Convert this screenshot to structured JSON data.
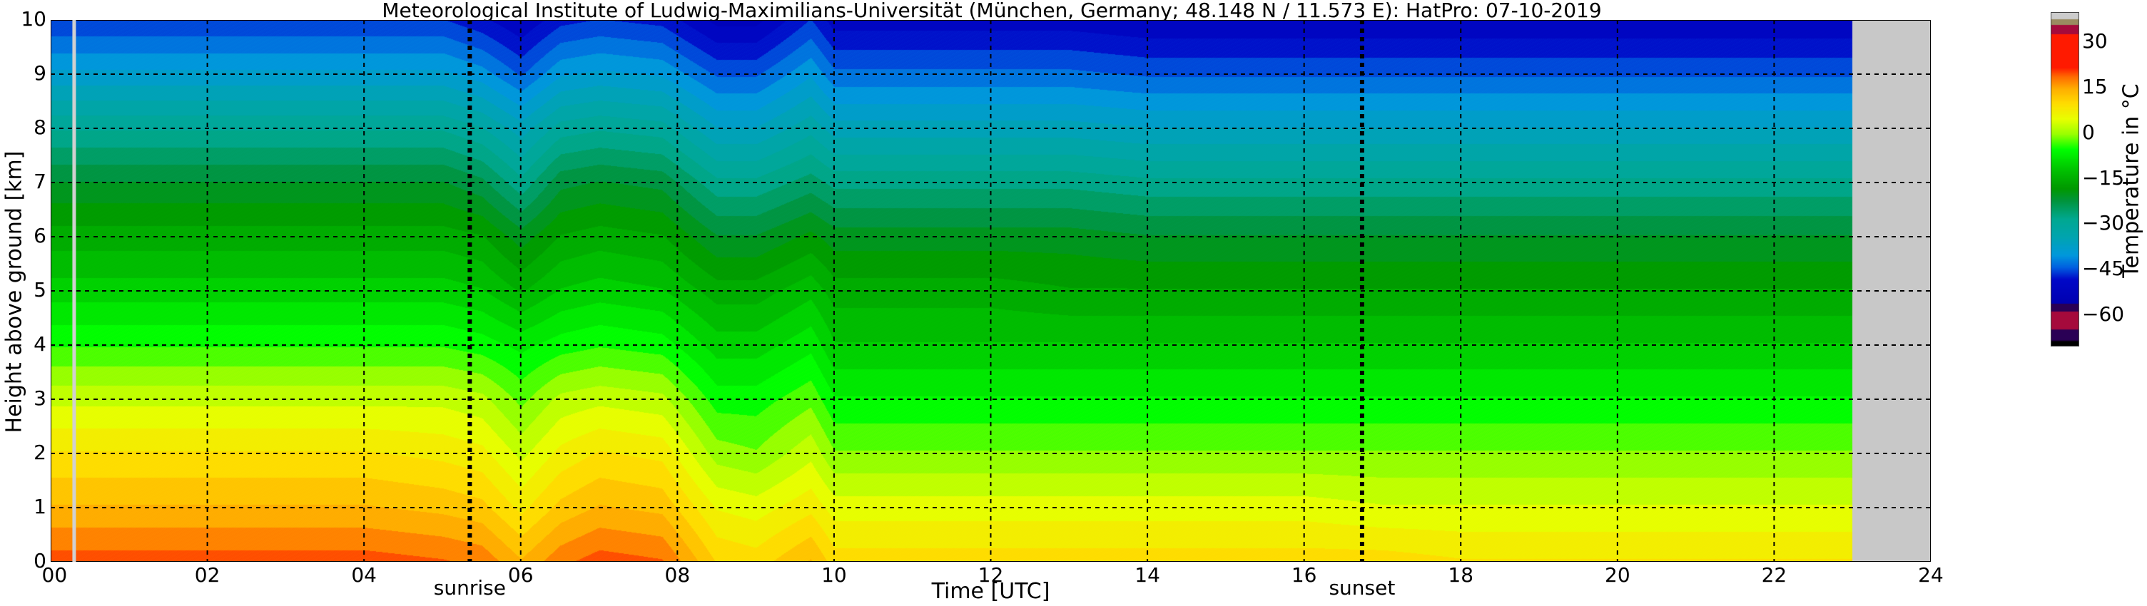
{
  "chart_data": {
    "type": "heatmap",
    "title": "Meteorological Institute of Ludwig-Maximilians-Universität (München, Germany; 48.148 N / 11.573 E):     HatPro: 07-10-2019",
    "xlabel": "Time [UTC]",
    "ylabel": "Height above ground [km]",
    "colorbar_label": "Temperature in °C",
    "xlim": [
      0,
      24
    ],
    "ylim": [
      0,
      10
    ],
    "clim": [
      -70,
      40
    ],
    "xticks": [
      "00",
      "02",
      "04",
      "06",
      "08",
      "10",
      "12",
      "14",
      "16",
      "18",
      "20",
      "22",
      "24"
    ],
    "xtick_values": [
      0,
      2,
      4,
      6,
      8,
      10,
      12,
      14,
      16,
      18,
      20,
      22,
      24
    ],
    "yticks": [
      "0",
      "1",
      "2",
      "3",
      "4",
      "5",
      "6",
      "7",
      "8",
      "9",
      "10"
    ],
    "cticks": [
      "30",
      "15",
      "0",
      "−15",
      "−30",
      "−45",
      "−60"
    ],
    "ctick_values": [
      30,
      15,
      0,
      -15,
      -30,
      -45,
      -60
    ],
    "grid": true,
    "annotations": [
      {
        "label": "sunrise",
        "time": 5.35
      },
      {
        "label": "sunset",
        "time": 16.74
      }
    ],
    "no_data_from": 23.0,
    "gap_line_time": 0.3,
    "heights": [
      0,
      1,
      2,
      3,
      4,
      5,
      6,
      7,
      8,
      9,
      10
    ],
    "times": [
      0,
      1,
      2,
      3,
      4,
      5,
      5.5,
      6,
      6.5,
      7,
      7.8,
      8.5,
      9,
      9.7,
      10,
      11,
      12,
      13,
      14,
      15,
      16,
      17,
      18,
      19,
      20,
      21,
      22,
      23
    ],
    "z": [
      [
        20,
        14,
        9,
        3,
        -4,
        -10,
        -15,
        -21,
        -29,
        -38,
        -46
      ],
      [
        20,
        14,
        9,
        3,
        -4,
        -10,
        -15,
        -21,
        -29,
        -38,
        -46
      ],
      [
        20,
        14,
        9,
        3,
        -4,
        -10,
        -15,
        -21,
        -29,
        -38,
        -46
      ],
      [
        20,
        14,
        9,
        3,
        -4,
        -10,
        -15,
        -21,
        -29,
        -38,
        -46
      ],
      [
        20,
        14,
        9,
        3,
        -4,
        -10,
        -15,
        -21,
        -29,
        -38,
        -46
      ],
      [
        19,
        13,
        8,
        3,
        -4,
        -10,
        -15,
        -21,
        -29,
        -38,
        -46
      ],
      [
        18,
        12,
        7,
        2,
        -5,
        -11,
        -16,
        -23,
        -31,
        -40,
        -48
      ],
      [
        14,
        8,
        3,
        -2,
        -7,
        -14,
        -20,
        -28,
        -35,
        -44,
        -51
      ],
      [
        18,
        12,
        7,
        2,
        -5,
        -11,
        -16,
        -22,
        -30,
        -39,
        -47
      ],
      [
        20,
        14,
        9,
        3,
        -4,
        -10,
        -15,
        -21,
        -29,
        -38,
        -46
      ],
      [
        19,
        13,
        8,
        2,
        -5,
        -11,
        -16,
        -22,
        -30,
        -39,
        -47
      ],
      [
        11,
        6,
        0,
        -5,
        -10,
        -15,
        -21,
        -28,
        -36,
        -44,
        -52
      ],
      [
        10,
        5,
        -1,
        -5,
        -10,
        -15,
        -21,
        -28,
        -36,
        -44,
        -52
      ],
      [
        14,
        8,
        3,
        -2,
        -7,
        -12,
        -18,
        -25,
        -32,
        -39,
        -46
      ],
      [
        10,
        5,
        -1,
        -6,
        -11,
        -15,
        -20,
        -27,
        -35,
        -43,
        -50
      ],
      [
        10,
        5,
        -1,
        -6,
        -11,
        -15,
        -20,
        -27,
        -35,
        -43,
        -50
      ],
      [
        10,
        5,
        -1,
        -6,
        -11,
        -15,
        -20,
        -27,
        -35,
        -43,
        -50
      ],
      [
        10,
        5,
        -1,
        -6,
        -11,
        -16,
        -20,
        -27,
        -35,
        -43,
        -50
      ],
      [
        10,
        5,
        -1,
        -6,
        -11,
        -16,
        -21,
        -28,
        -36,
        -44,
        -51
      ],
      [
        10,
        5,
        -1,
        -6,
        -11,
        -16,
        -21,
        -28,
        -36,
        -44,
        -51
      ],
      [
        10,
        5,
        -1,
        -6,
        -11,
        -16,
        -21,
        -28,
        -36,
        -44,
        -51
      ],
      [
        10,
        4,
        -1,
        -6,
        -11,
        -16,
        -21,
        -28,
        -36,
        -44,
        -51
      ],
      [
        9,
        4,
        -1,
        -6,
        -11,
        -16,
        -21,
        -28,
        -36,
        -44,
        -51
      ],
      [
        9,
        4,
        -1,
        -6,
        -11,
        -16,
        -21,
        -28,
        -36,
        -44,
        -51
      ],
      [
        9,
        4,
        -1,
        -6,
        -11,
        -16,
        -21,
        -28,
        -36,
        -44,
        -51
      ],
      [
        9,
        4,
        -1,
        -6,
        -11,
        -16,
        -21,
        -28,
        -36,
        -44,
        -51
      ],
      [
        9,
        4,
        -1,
        -6,
        -11,
        -16,
        -21,
        -28,
        -36,
        -44,
        -51
      ],
      [
        9,
        4,
        -1,
        -6,
        -11,
        -16,
        -21,
        -28,
        -36,
        -44,
        -51
      ]
    ],
    "colormap": [
      [
        -70,
        "#000000"
      ],
      [
        -68.5,
        "#000000"
      ],
      [
        -68,
        "#2a0055"
      ],
      [
        -64.6,
        "#2a0055"
      ],
      [
        -64.5,
        "#a50a3c"
      ],
      [
        -58.6,
        "#a50a3c"
      ],
      [
        -58.5,
        "#2a0055"
      ],
      [
        -56.1,
        "#2a0055"
      ],
      [
        -56,
        "#0000b0"
      ],
      [
        -48,
        "#0008c8"
      ],
      [
        -44,
        "#0060e0"
      ],
      [
        -40,
        "#0098dc"
      ],
      [
        -34,
        "#00a4b0"
      ],
      [
        -28,
        "#00a890"
      ],
      [
        -22,
        "#00943c"
      ],
      [
        -18,
        "#009900"
      ],
      [
        -12,
        "#00c000"
      ],
      [
        -5,
        "#00ff00"
      ],
      [
        0,
        "#99ff00"
      ],
      [
        5,
        "#e8ff00"
      ],
      [
        10,
        "#ffdd00"
      ],
      [
        15,
        "#ffae00"
      ],
      [
        19,
        "#ff6a00"
      ],
      [
        22,
        "#ff1a00"
      ],
      [
        33,
        "#ff1a00"
      ],
      [
        33.1,
        "#a50a3c"
      ],
      [
        36,
        "#a50a3c"
      ],
      [
        36.1,
        "#9a8a60"
      ],
      [
        38,
        "#9a8a60"
      ],
      [
        38.1,
        "#cccccc"
      ],
      [
        40,
        "#cccccc"
      ]
    ],
    "no_data_color": "#c8c8c8"
  }
}
